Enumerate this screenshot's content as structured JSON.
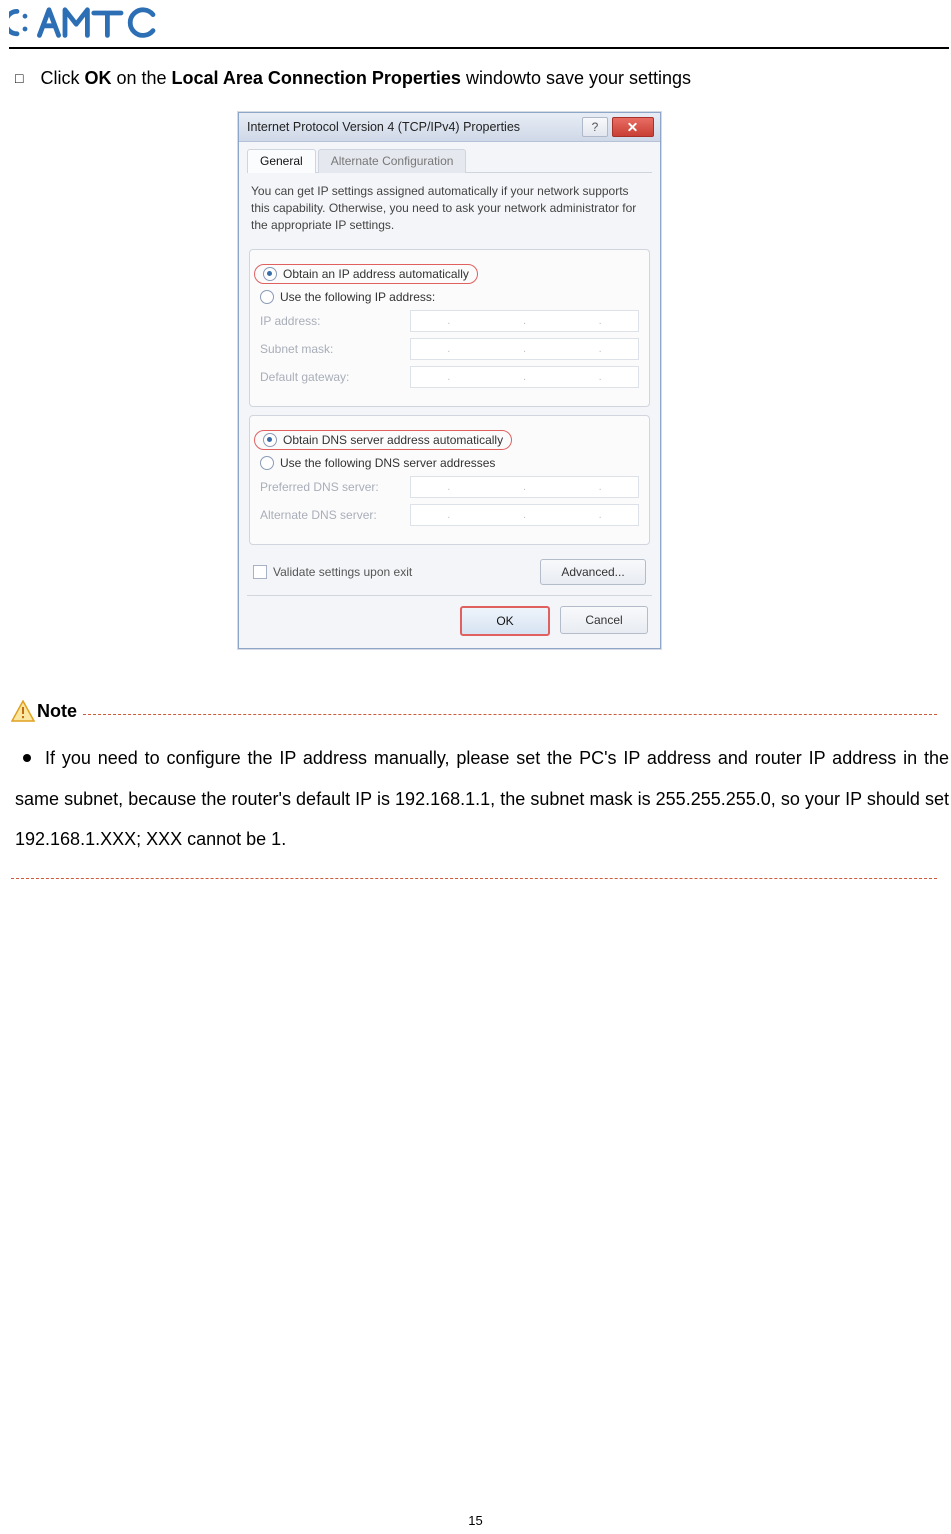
{
  "page_number": "15",
  "logo_text": "AMTC",
  "instruction": {
    "pre": "Click ",
    "ok": "OK",
    "mid": " on the ",
    "bold2": "Local Area Connection Properties",
    "post": " windowto save your settings"
  },
  "dialog": {
    "title": "Internet Protocol Version 4 (TCP/IPv4) Properties",
    "help_glyph": "?",
    "tabs": {
      "general": "General",
      "alt": "Alternate Configuration"
    },
    "desc": "You can get IP settings assigned automatically if your network supports this capability. Otherwise, you need to ask your network administrator for the appropriate IP settings.",
    "ip_group": {
      "auto": "Obtain an IP address automatically",
      "manual": "Use the following IP address:",
      "fields": {
        "ip": "IP address:",
        "mask": "Subnet mask:",
        "gw": "Default gateway:"
      }
    },
    "dns_group": {
      "auto": "Obtain DNS server address automatically",
      "manual": "Use the following DNS server addresses",
      "fields": {
        "pref": "Preferred DNS server:",
        "alt": "Alternate DNS server:"
      }
    },
    "validate": "Validate settings upon exit",
    "advanced": "Advanced...",
    "ok_btn": "OK",
    "cancel_btn": "Cancel",
    "dot": "."
  },
  "note_label": "Note",
  "note_text": "If you need to configure the IP address manually, please set the PC's IP address and router IP address in the same subnet, because the router's default IP is 192.168.1.1, the subnet mask is 255.255.255.0, so your IP should set 192.168.1.XXX; XXX cannot be 1."
}
